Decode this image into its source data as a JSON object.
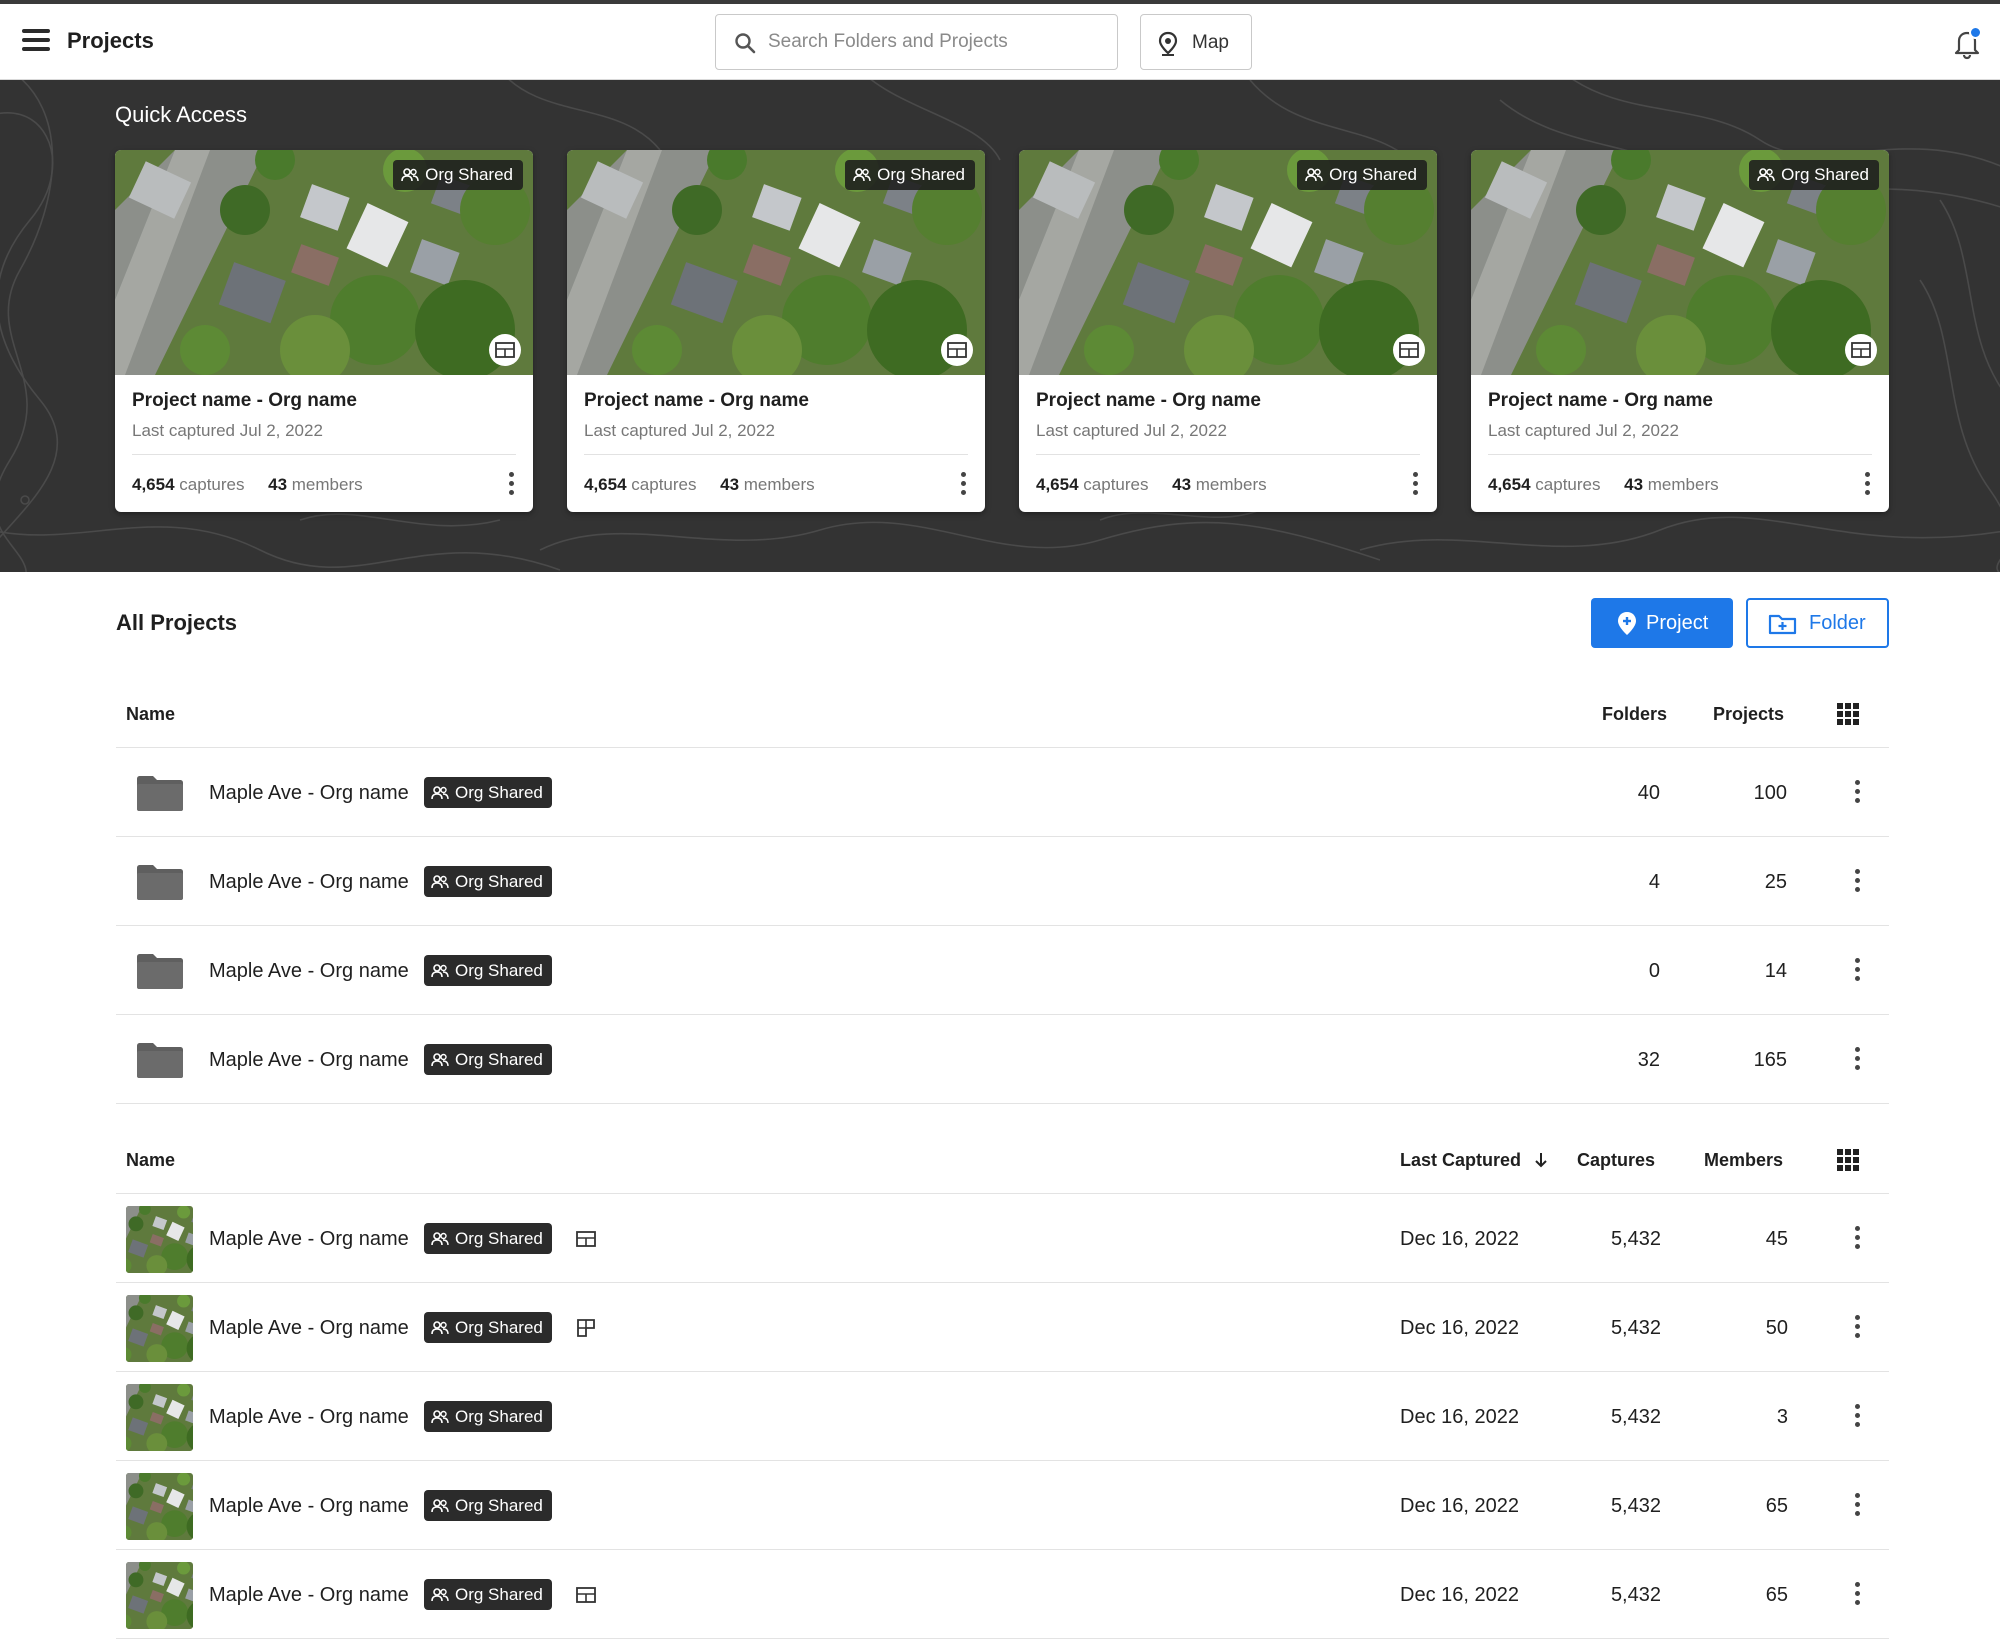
{
  "header": {
    "title": "Projects",
    "search_placeholder": "Search Folders and Projects",
    "map_label": "Map",
    "accent": "#1e78e8"
  },
  "quick_access": {
    "title": "Quick Access",
    "cards": [
      {
        "badge": "Org Shared",
        "name": "Project name - Org name",
        "subtitle": "Last captured Jul 2, 2022",
        "captures_count": "4,654",
        "captures_label": "captures",
        "members_count": "43",
        "members_label": "members"
      },
      {
        "badge": "Org Shared",
        "name": "Project name - Org name",
        "subtitle": "Last captured Jul 2, 2022",
        "captures_count": "4,654",
        "captures_label": "captures",
        "members_count": "43",
        "members_label": "members"
      },
      {
        "badge": "Org Shared",
        "name": "Project name - Org name",
        "subtitle": "Last captured Jul 2, 2022",
        "captures_count": "4,654",
        "captures_label": "captures",
        "members_count": "43",
        "members_label": "members"
      },
      {
        "badge": "Org Shared",
        "name": "Project name - Org name",
        "subtitle": "Last captured Jul 2, 2022",
        "captures_count": "4,654",
        "captures_label": "captures",
        "members_count": "43",
        "members_label": "members"
      }
    ]
  },
  "all_projects": {
    "title": "All Projects",
    "project_button": "Project",
    "folder_button": "Folder",
    "folders_table": {
      "headers": {
        "name": "Name",
        "folders": "Folders",
        "projects": "Projects"
      },
      "rows": [
        {
          "name": "Maple Ave - Org name",
          "badge": "Org Shared",
          "folders": "40",
          "projects": "100"
        },
        {
          "name": "Maple Ave - Org name",
          "badge": "Org Shared",
          "folders": "4",
          "projects": "25"
        },
        {
          "name": "Maple Ave - Org name",
          "badge": "Org Shared",
          "folders": "0",
          "projects": "14"
        },
        {
          "name": "Maple Ave - Org name",
          "badge": "Org Shared",
          "folders": "32",
          "projects": "165"
        }
      ]
    },
    "projects_table": {
      "headers": {
        "name": "Name",
        "last_captured": "Last Captured",
        "captures": "Captures",
        "members": "Members"
      },
      "sort_icon": "arrow-down-icon",
      "rows": [
        {
          "name": "Maple Ave - Org name",
          "badge": "Org Shared",
          "type_icon": "layout-icon",
          "last_captured": "Dec 16, 2022",
          "captures": "5,432",
          "members": "45"
        },
        {
          "name": "Maple Ave - Org name",
          "badge": "Org Shared",
          "type_icon": "floorplan-icon",
          "last_captured": "Dec 16, 2022",
          "captures": "5,432",
          "members": "50"
        },
        {
          "name": "Maple Ave - Org name",
          "badge": "Org Shared",
          "type_icon": "",
          "last_captured": "Dec 16, 2022",
          "captures": "5,432",
          "members": "3"
        },
        {
          "name": "Maple Ave - Org name",
          "badge": "Org Shared",
          "type_icon": "",
          "last_captured": "Dec 16, 2022",
          "captures": "5,432",
          "members": "65"
        },
        {
          "name": "Maple Ave - Org name",
          "badge": "Org Shared",
          "type_icon": "layout-icon",
          "last_captured": "Dec 16, 2022",
          "captures": "5,432",
          "members": "65"
        }
      ]
    }
  }
}
